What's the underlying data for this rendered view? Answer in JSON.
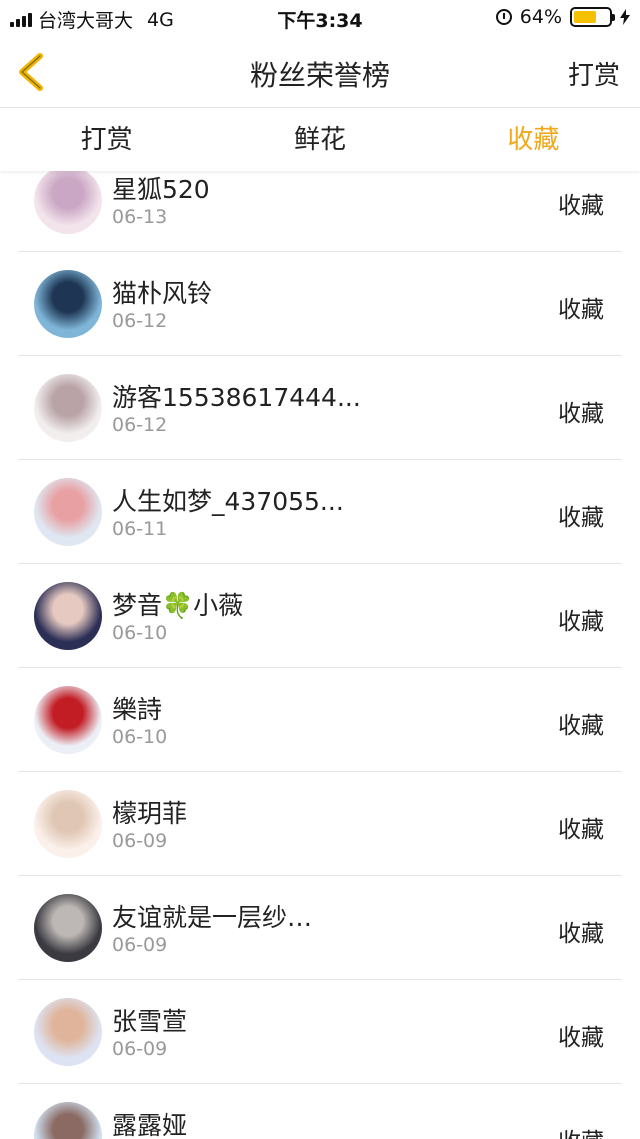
{
  "status_bar": {
    "carrier": "台湾大哥大",
    "network": "4G",
    "time": "下午3:34",
    "battery_percent": "64%",
    "battery_level": 0.64,
    "battery_color": "#f5c000"
  },
  "nav": {
    "back_icon": "chevron-left-icon",
    "back_color": "#f0b400",
    "title": "粉丝荣誉榜",
    "right_label": "打赏"
  },
  "tabs": [
    {
      "label": "打赏",
      "active": false
    },
    {
      "label": "鲜花",
      "active": false
    },
    {
      "label": "收藏",
      "active": true
    }
  ],
  "accent_color": "#f0a81c",
  "items": [
    {
      "name": "星狐520",
      "date": "06-13",
      "action": "收藏",
      "avatar_colors": [
        "#f3e4ec",
        "#caa7c4"
      ]
    },
    {
      "name": "猫朴风铃",
      "date": "06-12",
      "action": "收藏",
      "avatar_colors": [
        "#7fb6d8",
        "#1e3553"
      ]
    },
    {
      "name": "游客15538617444...",
      "date": "06-12",
      "action": "收藏",
      "avatar_colors": [
        "#f2eeee",
        "#b9a3a7"
      ]
    },
    {
      "name": "人生如梦_437055...",
      "date": "06-11",
      "action": "收藏",
      "avatar_colors": [
        "#dfe8f2",
        "#e8a0a3"
      ]
    },
    {
      "name": "梦音🍀小薇",
      "date": "06-10",
      "action": "收藏",
      "avatar_colors": [
        "#2b2e55",
        "#e6c9c1"
      ]
    },
    {
      "name": "樂詩",
      "date": "06-10",
      "action": "收藏",
      "avatar_colors": [
        "#eceff5",
        "#c21c24"
      ]
    },
    {
      "name": "檬玥菲",
      "date": "06-09",
      "action": "收藏",
      "avatar_colors": [
        "#fbf0ea",
        "#e0c7b5"
      ]
    },
    {
      "name": "友谊就是一层纱…",
      "date": "06-09",
      "action": "收藏",
      "avatar_colors": [
        "#3a3a40",
        "#bdb7b5"
      ]
    },
    {
      "name": "张雪萱",
      "date": "06-09",
      "action": "收藏",
      "avatar_colors": [
        "#dde3f2",
        "#e0b49a"
      ]
    },
    {
      "name": "露露娅",
      "date": "",
      "action": "收藏",
      "avatar_colors": [
        "#cfe0ef",
        "#8a6a63"
      ]
    }
  ]
}
